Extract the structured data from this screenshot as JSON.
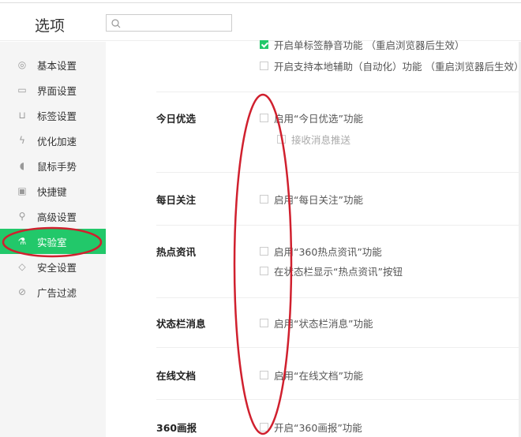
{
  "header": {
    "title": "选项",
    "search": {
      "value": "",
      "placeholder": ""
    }
  },
  "sidebar": {
    "items": [
      {
        "label": "基本设置",
        "icon": "circle-gear-icon"
      },
      {
        "label": "界面设置",
        "icon": "window-icon"
      },
      {
        "label": "标签设置",
        "icon": "tab-icon"
      },
      {
        "label": "优化加速",
        "icon": "lightning-icon"
      },
      {
        "label": "鼠标手势",
        "icon": "mouse-icon"
      },
      {
        "label": "快捷键",
        "icon": "keyboard-icon"
      },
      {
        "label": "高级设置",
        "icon": "wrench-icon"
      },
      {
        "label": "实验室",
        "icon": "flask-icon",
        "active": true
      },
      {
        "label": "安全设置",
        "icon": "shield-icon"
      },
      {
        "label": "广告过滤",
        "icon": "block-icon"
      }
    ]
  },
  "top_options": [
    {
      "label": "开启单标签静音功能 （重启浏览器后生效）",
      "checked": true
    },
    {
      "label": "开启支持本地辅助（自动化）功能 （重启浏览器后生效）",
      "checked": false
    }
  ],
  "sections": [
    {
      "title": "今日优选",
      "options": [
        {
          "label": "启用“今日优选”功能",
          "checked": false
        },
        {
          "label": "接收消息推送",
          "checked": false,
          "disabled": true
        }
      ]
    },
    {
      "title": "每日关注",
      "options": [
        {
          "label": "启用“每日关注”功能",
          "checked": false
        }
      ]
    },
    {
      "title": "热点资讯",
      "options": [
        {
          "label": "启用“360热点资讯”功能",
          "checked": false
        },
        {
          "label": "在状态栏显示“热点资讯”按钮",
          "checked": false
        }
      ]
    },
    {
      "title": "状态栏消息",
      "options": [
        {
          "label": "启用“状态栏消息”功能",
          "checked": false
        }
      ]
    },
    {
      "title": "在线文档",
      "options": [
        {
          "label": "启用“在线文档”功能",
          "checked": false
        }
      ]
    },
    {
      "title": "360画报",
      "options": [
        {
          "label": "开启“360画报”功能",
          "checked": false
        }
      ]
    }
  ],
  "colors": {
    "accent": "#22c86a",
    "annotation": "#d0202e"
  }
}
